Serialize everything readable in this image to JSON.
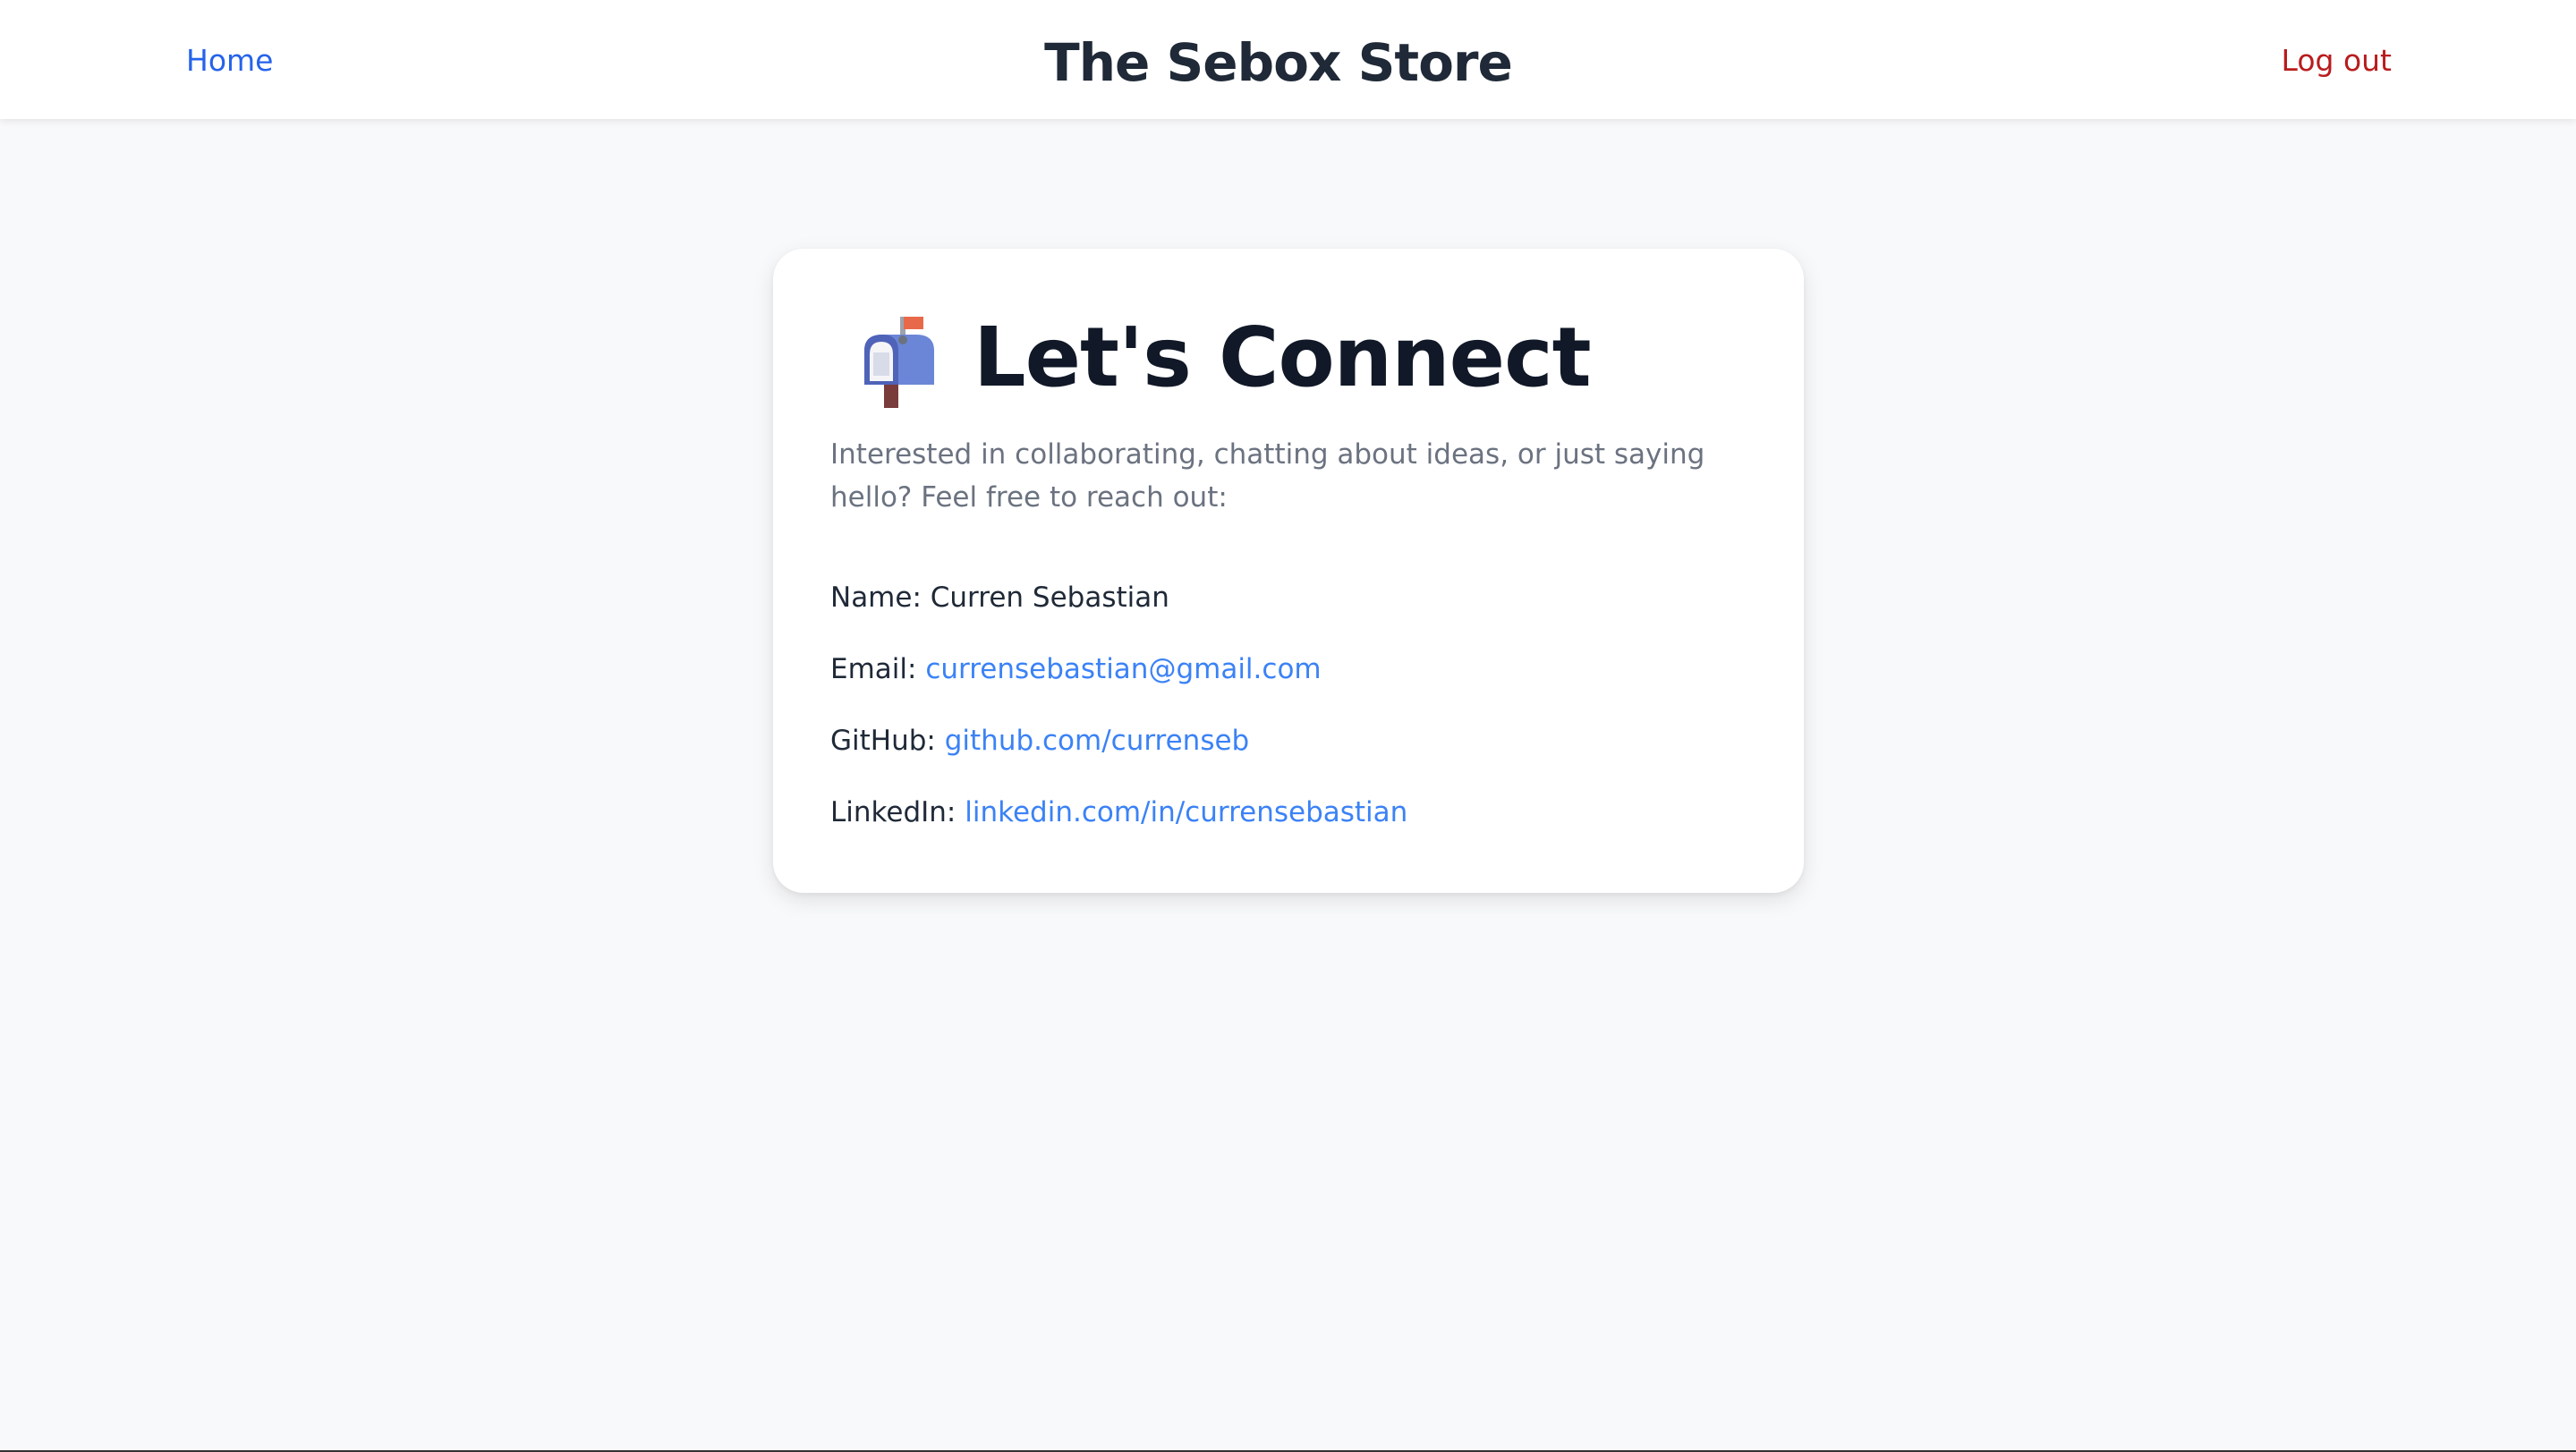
{
  "nav": {
    "home_label": "Home",
    "brand": "The Sebox Store",
    "logout_label": "Log out"
  },
  "contact": {
    "icon": "mailbox-icon",
    "heading": "Let's Connect",
    "intro": "Interested in collaborating, chatting about ideas, or just saying hello? Feel free to reach out:",
    "name_label": "Name:",
    "name_value": "Curren Sebastian",
    "email_label": "Email:",
    "email_value": "currensebastian@gmail.com",
    "github_label": "GitHub:",
    "github_value": "github.com/currenseb",
    "linkedin_label": "LinkedIn:",
    "linkedin_value": "linkedin.com/in/currensebastian"
  },
  "colors": {
    "link": "#3b82f6",
    "nav_link": "#2563eb",
    "logout": "#b91c1c",
    "background": "#f8f9fb",
    "heading": "#111827"
  }
}
